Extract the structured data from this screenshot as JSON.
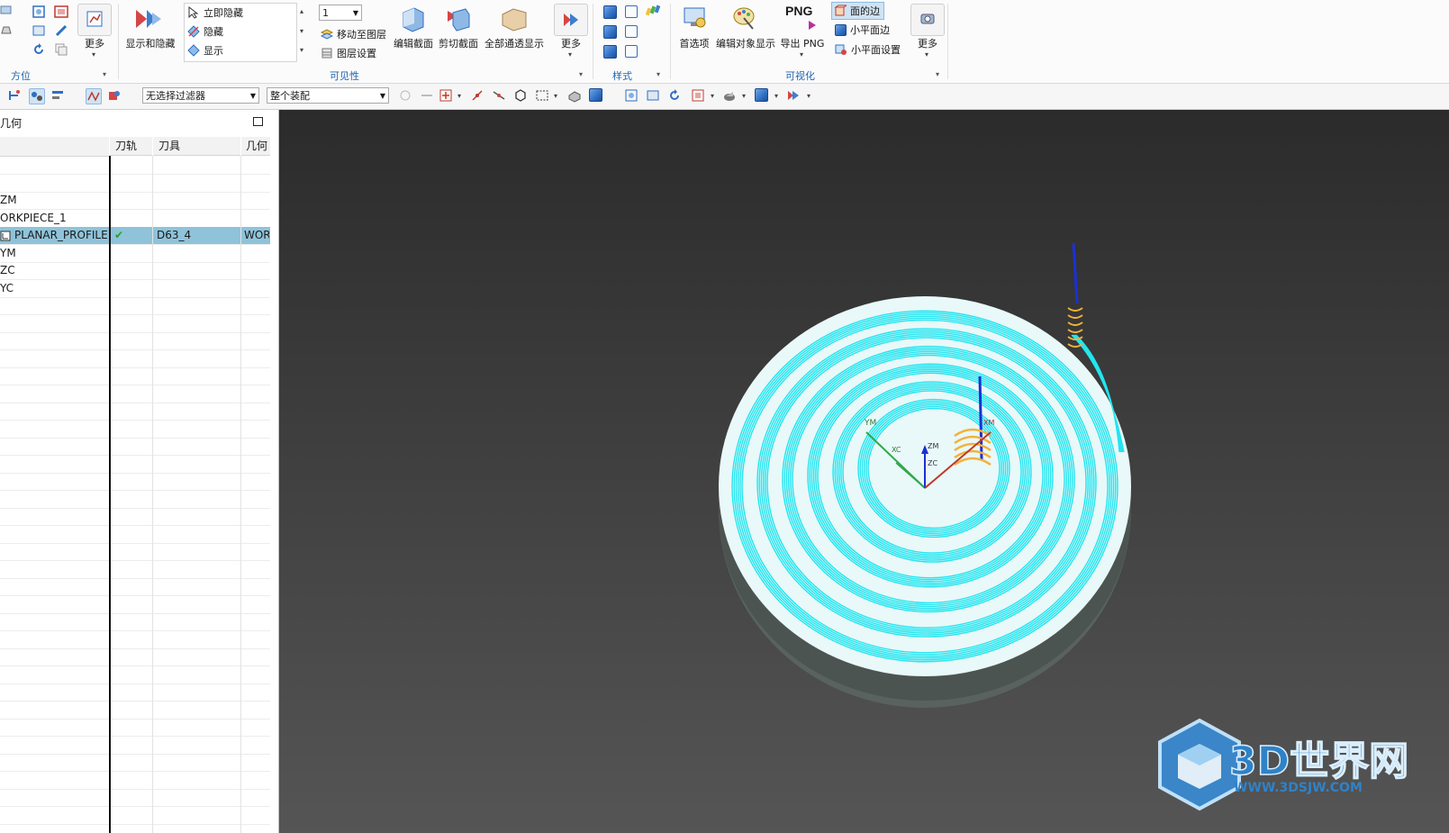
{
  "ribbon": {
    "groups": {
      "orientation": "方位",
      "visibility": "可见性",
      "style": "样式",
      "visualization": "可视化"
    },
    "more_label": "更多",
    "show_hide_label": "显示和隐藏",
    "hide_now_label": "立即隐藏",
    "hide_label": "隐藏",
    "show_label": "显示",
    "layer_value": "1",
    "move_to_layer_label": "移动至图层",
    "layer_settings_label": "图层设置",
    "edit_section_label": "编辑截面",
    "clip_section_label": "剪切截面",
    "show_all_through_label": "全部通透显示",
    "preferences_label": "首选项",
    "edit_object_display_label": "编辑对象显示",
    "export_png_top": "PNG",
    "export_png_label": "导出 PNG",
    "face_edges_label": "面的边",
    "facet_edges_label": "小平面边",
    "facet_settings_label": "小平面设置"
  },
  "toolbar2": {
    "filter_value": "无选择过滤器",
    "scope_value": "整个装配"
  },
  "navigator": {
    "title": "几何",
    "columns": [
      "刀轨",
      "刀具",
      "几何"
    ],
    "rows": [
      {
        "name": "",
        "path": "",
        "tool": "",
        "geom": ""
      },
      {
        "name": "",
        "path": "",
        "tool": "",
        "geom": ""
      },
      {
        "name": "ZM",
        "path": "",
        "tool": "",
        "geom": ""
      },
      {
        "name": "ORKPIECE_1",
        "path": "",
        "tool": "",
        "geom": ""
      },
      {
        "name": "PLANAR_PROFILE",
        "path": "✔",
        "tool": "D63_4",
        "geom": "WOR"
      },
      {
        "name": "YM",
        "path": "",
        "tool": "",
        "geom": ""
      },
      {
        "name": "ZC",
        "path": "",
        "tool": "",
        "geom": ""
      },
      {
        "name": "YC",
        "path": "",
        "tool": "",
        "geom": ""
      }
    ]
  },
  "viewport": {
    "axis_labels": [
      "YM",
      "XC",
      "ZM",
      "ZC",
      "XM"
    ],
    "watermark_text": "3D世界网",
    "watermark_url": "WWW.3DSJW.COM"
  },
  "colors": {
    "toolpath": "#22e5f0",
    "part_top": "#e9f8f8",
    "part_side": "#5a6460",
    "accent": "#1d63b0",
    "selection": "#8fc3d9"
  }
}
